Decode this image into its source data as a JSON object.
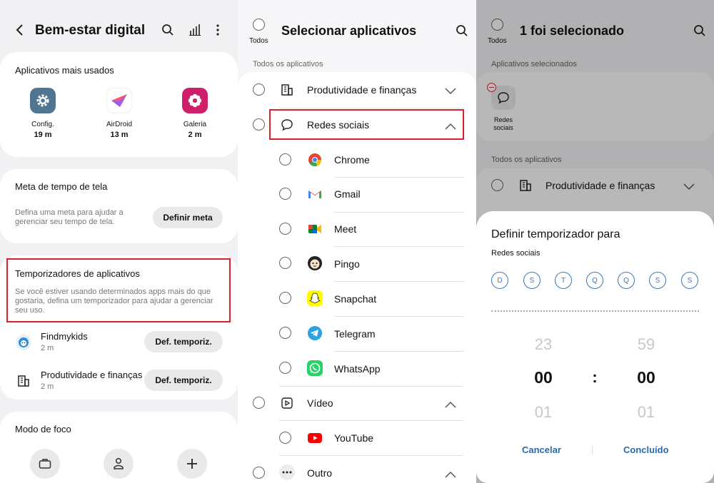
{
  "panel1": {
    "title": "Bem-estar digital",
    "most_used": {
      "title": "Aplicativos mais usados",
      "apps": [
        {
          "name": "Config.",
          "time": "19 m"
        },
        {
          "name": "AirDroid",
          "time": "13 m"
        },
        {
          "name": "Galeria",
          "time": "2 m"
        }
      ]
    },
    "screen_goal": {
      "title": "Meta de tempo de tela",
      "desc": "Defina uma meta para ajudar a gerenciar seu tempo de tela.",
      "button": "Definir meta"
    },
    "app_timers": {
      "title": "Temporizadores de aplicativos",
      "desc": "Se você estiver usando determinados apps mais do que gostaria, defina um temporizador para ajudar a gerenciar seu uso.",
      "items": [
        {
          "name": "Findmykids",
          "time": "2 m",
          "button": "Def. temporiz."
        },
        {
          "name": "Produtividade e finanças",
          "time": "2 m",
          "button": "Def. temporiz."
        }
      ]
    },
    "focus": {
      "title": "Modo de foco"
    }
  },
  "panel2": {
    "all_label": "Todos",
    "title": "Selecionar aplicativos",
    "section": "Todos os aplicativos",
    "categories": {
      "productivity": "Produtividade e finanças",
      "social": "Redes sociais",
      "video": "Vídeo",
      "other": "Outro"
    },
    "social_apps": [
      "Chrome",
      "Gmail",
      "Meet",
      "Pingo",
      "Snapchat",
      "Telegram",
      "WhatsApp"
    ],
    "video_apps": [
      "YouTube"
    ]
  },
  "panel3": {
    "all_label": "Todos",
    "title": "1 foi selecionado",
    "selected_label": "Aplicativos selecionados",
    "selected_app": "Redes sociais",
    "section": "Todos os aplicativos",
    "productivity": "Produtividade e finanças",
    "sheet": {
      "title": "Definir temporizador para",
      "subtitle": "Redes sociais",
      "days": [
        "D",
        "S",
        "T",
        "Q",
        "Q",
        "S",
        "S"
      ],
      "hours_prev": "23",
      "hours": "00",
      "hours_next": "01",
      "sep": ":",
      "mins_prev": "59",
      "mins": "00",
      "mins_next": "01",
      "cancel": "Cancelar",
      "done": "Concluído"
    }
  },
  "colors": {
    "accent": "#3c78b8",
    "highlight": "#e11d2c"
  }
}
